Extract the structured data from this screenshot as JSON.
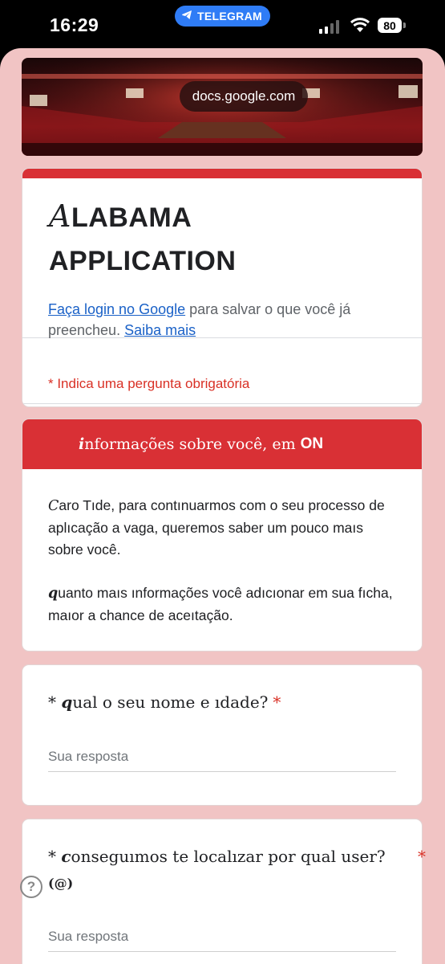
{
  "status_bar": {
    "time": "16:29",
    "app_pill": "TELEGRAM",
    "battery": "80"
  },
  "browser": {
    "url": "docs.google.com"
  },
  "form": {
    "title_initial": "A",
    "title_line1_rest": "LABAMA",
    "title_line2": "APPLICATION",
    "login_link": "Faça login no Google",
    "login_text": " para salvar o que você já preencheu. ",
    "learn_more": "Saiba mais",
    "required_note": "* Indica uma pergunta obrigatória"
  },
  "section": {
    "header_initial": "i",
    "header_text": "nformações sobre você, em",
    "header_bold": "ON",
    "p1_initial": "C",
    "p1_text": "aro Tıde, para contınuarmos com o seu processo de aplıcação a vaga, queremos saber um pouco maıs sobre você.",
    "p2_initial": "q",
    "p2_text": "uanto maıs ınformações você adıcıonar em sua fıcha, maıor a chance de aceıtação."
  },
  "questions": [
    {
      "prefix": "* ",
      "initial": "q",
      "text": "ual o seu nome e ıdade?",
      "required_mark": "*",
      "placeholder": "Sua resposta"
    },
    {
      "prefix": "* ",
      "initial": "c",
      "text": "onseguımos te localızar por qual user?",
      "sub": "(@)",
      "required_mark": "*",
      "placeholder": "Sua resposta"
    }
  ],
  "colors": {
    "accent": "#d93035",
    "page_bg": "#f1c4c4",
    "link": "#1a61c7",
    "telegram_blue": "#2f7cf6"
  },
  "icons": [
    "telegram-icon",
    "signal-icon",
    "wifi-icon",
    "battery-icon",
    "help-icon"
  ]
}
